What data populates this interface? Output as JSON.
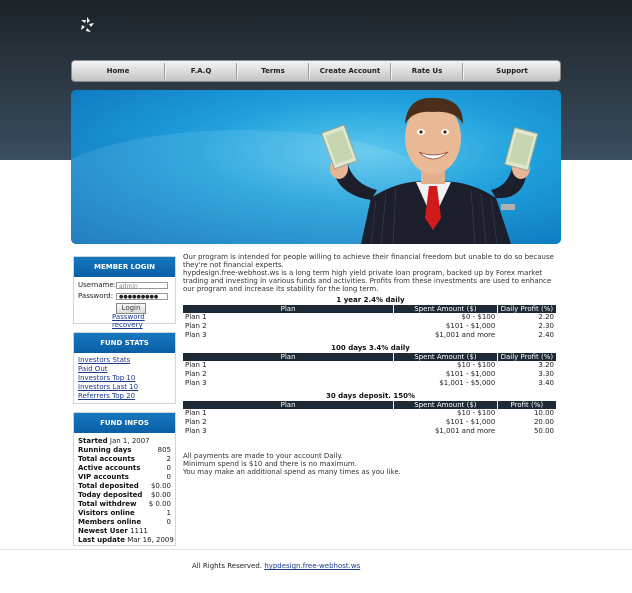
{
  "nav": {
    "items": [
      "Home",
      "F.A.Q",
      "Terms",
      "Create Account",
      "Rate Us",
      "Support"
    ]
  },
  "login": {
    "title": "MEMBER LOGIN",
    "username_label": "Username:",
    "username_value": "admin",
    "password_label": "Password:",
    "password_value": "●●●●●●●●●",
    "login_button": "Login",
    "recovery_link": "Password recovery"
  },
  "fund_stats": {
    "title": "FUND STATS",
    "links": [
      "Investors Stats",
      "Paid Out",
      "Investors Top 10",
      "Investors Last 10",
      "Referrers Top 20"
    ]
  },
  "fund_infos": {
    "title": "FUND INFOS",
    "rows": [
      {
        "label": "Started",
        "value": "Jan 1, 2007",
        "inline": true
      },
      {
        "label": "Running days",
        "value": "805"
      },
      {
        "label": "Total accounts",
        "value": "2"
      },
      {
        "label": "Active accounts",
        "value": "0"
      },
      {
        "label": "VIP accounts",
        "value": "0"
      },
      {
        "label": "Total deposited",
        "value": "$0.00"
      },
      {
        "label": "Today deposited",
        "value": "$0.00"
      },
      {
        "label": "Total withdrew",
        "value": "$ 0.00"
      },
      {
        "label": "Visitors online",
        "value": "1"
      },
      {
        "label": "Members online",
        "value": "0"
      },
      {
        "label": "Newest User",
        "value": "1111",
        "inline": true
      },
      {
        "label": "Last update",
        "value": "Mar 16, 2009",
        "inline": true
      }
    ]
  },
  "intro": {
    "p1": "Our program is intended for people willing to achieve their financial freedom but unable to do so because they're not financial experts.",
    "p2": "hypdesign.free-webhost.ws is a long term high yield private loan program, backed up by Forex market trading and investing in various funds and activities. Profits from these investments are used to enhance our program and increase its stability for the long term."
  },
  "plans": [
    {
      "title": "1 year 2.4% daily",
      "headers": [
        "Plan",
        "Spent Amount ($)",
        "Daily Profit (%)"
      ],
      "rows": [
        [
          "Plan 1",
          "$0 - $100",
          "2.20"
        ],
        [
          "Plan 2",
          "$101 - $1,000",
          "2.30"
        ],
        [
          "Plan 3",
          "$1,001 and more",
          "2.40"
        ]
      ]
    },
    {
      "title": "100 days 3.4% daily",
      "headers": [
        "Plan",
        "Spent Amount ($)",
        "Daily Profit (%)"
      ],
      "rows": [
        [
          "Plan 1",
          "$10 - $100",
          "3.20"
        ],
        [
          "Plan 2",
          "$101 - $1,000",
          "3.30"
        ],
        [
          "Plan 3",
          "$1,001 - $5,000",
          "3.40"
        ]
      ]
    },
    {
      "title": "30 days deposit. 150%",
      "headers": [
        "Plan",
        "Spent Amount ($)",
        "Profit (%)"
      ],
      "rows": [
        [
          "Plan 1",
          "$10 - $100",
          "10.00"
        ],
        [
          "Plan 2",
          "$101 - $1,000",
          "20.00"
        ],
        [
          "Plan 3",
          "$1,001 and more",
          "50.00"
        ]
      ]
    }
  ],
  "notes": {
    "line1": "All payments are made to your account Daily.",
    "line2": "Minimum spend is $10 and there is no maximum.",
    "line3": "You may make an additional spend as many times as you like."
  },
  "footer": {
    "text": "All Rights Reserved.",
    "link": "hypdesign.free-webhost.ws"
  },
  "colors": {
    "panel_header": "#0a5ea4",
    "table_header": "#1d2a36",
    "banner": "#1fa0dc",
    "link": "#1a3a8a"
  }
}
